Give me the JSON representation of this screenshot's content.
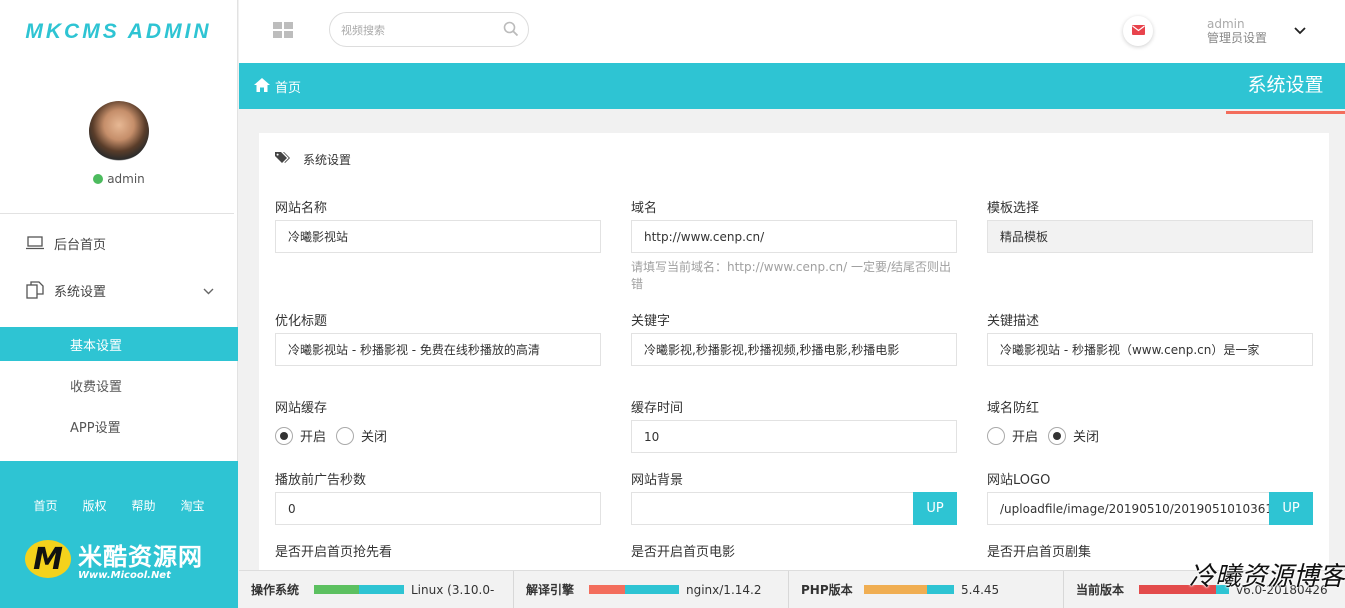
{
  "app": {
    "logo_text": "MKCMS ADMIN",
    "user_status": "admin"
  },
  "sidebar": {
    "items": [
      {
        "label": "后台首页",
        "icon": "monitor-icon"
      },
      {
        "label": "系统设置",
        "icon": "copy-icon"
      }
    ],
    "subitems": [
      {
        "label": "基本设置",
        "active": true
      },
      {
        "label": "收费设置",
        "active": false
      },
      {
        "label": "APP设置",
        "active": false
      }
    ],
    "footer_links": [
      "首页",
      "版权",
      "帮助",
      "淘宝"
    ],
    "brand": {
      "mark": "M",
      "name": "米酷资源网",
      "url": "Www.Micool.Net"
    }
  },
  "topbar": {
    "search_placeholder": "视频搜索",
    "admin_name": "admin",
    "admin_role": "管理员设置"
  },
  "breadcrumb": {
    "home": "首页",
    "page_title": "系统设置"
  },
  "card": {
    "header": "系统设置",
    "fields": {
      "site_name": {
        "label": "网站名称",
        "value": "冷曦影视站"
      },
      "domain": {
        "label": "域名",
        "value": "http://www.cenp.cn/",
        "hint": "请填写当前域名：http://www.cenp.cn/ 一定要/结尾否则出错"
      },
      "template": {
        "label": "模板选择",
        "value": "精品模板"
      },
      "seo_title": {
        "label": "优化标题",
        "value": "冷曦影视站 - 秒播影视 - 免费在线秒播放的高清"
      },
      "keywords": {
        "label": "关键字",
        "value": "冷曦影视,秒播影视,秒播视频,秒播电影,秒播电影"
      },
      "description": {
        "label": "关键描述",
        "value": "冷曦影视站 - 秒播影视（www.cenp.cn）是一家"
      },
      "cache": {
        "label": "网站缓存",
        "on": "开启",
        "off": "关闭",
        "selected": "on"
      },
      "cache_time": {
        "label": "缓存时间",
        "value": "10"
      },
      "anti_red": {
        "label": "域名防红",
        "on": "开启",
        "off": "关闭",
        "selected": "off"
      },
      "ad_seconds": {
        "label": "播放前广告秒数",
        "value": "0"
      },
      "background": {
        "label": "网站背景",
        "value": "",
        "button": "UP"
      },
      "logo": {
        "label": "网站LOGO",
        "value": "/uploadfile/image/20190510/2019051010361(",
        "button": "UP"
      },
      "home_preview": {
        "label": "是否开启首页抢先看"
      },
      "home_movie": {
        "label": "是否开启首页电影"
      },
      "home_series": {
        "label": "是否开启首页剧集"
      }
    }
  },
  "status": [
    {
      "label": "操作系统",
      "value": "Linux (3.10.0-"
    },
    {
      "label": "解译引擎",
      "value": "nginx/1.14.2"
    },
    {
      "label": "PHP版本",
      "value": "5.4.45"
    },
    {
      "label": "当前版本",
      "value": "v6.0-20180426"
    }
  ],
  "watermark": "冷曦资源博客",
  "colors": {
    "accent": "#2ec4d3",
    "title_underline": "#f36d5c",
    "online": "#4cbb5e"
  }
}
